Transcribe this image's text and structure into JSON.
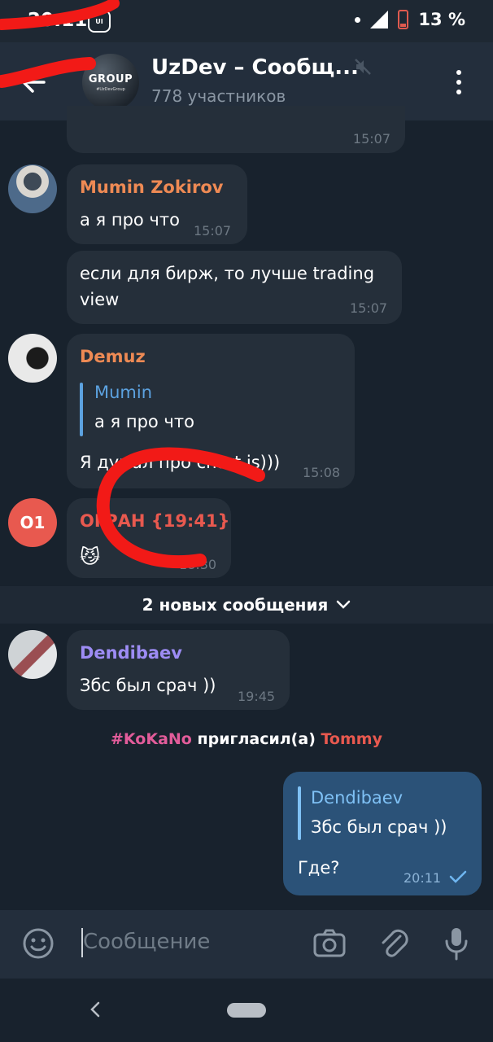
{
  "status_bar": {
    "time": "20:11",
    "app_icon": "app-icon",
    "battery": "13 %"
  },
  "header": {
    "title": "UzDev – Сообщ...",
    "members": "778 участников",
    "avatar_label": "GROUP",
    "avatar_sub": "#UzDevGroup"
  },
  "messages": {
    "m0": {
      "time": "15:07"
    },
    "m1": {
      "sender": "Mumin Zokirov",
      "text": "а я про что",
      "time": "15:07"
    },
    "m2": {
      "text_l1": "если для бирж, то лучше trading",
      "text_l2": "view",
      "time": "15:07"
    },
    "m3": {
      "sender": "Demuz",
      "reply_name": "Mumin",
      "reply_text": "а я про что",
      "text": "Я думал про chart.js)))",
      "time": "15:08"
    },
    "m4": {
      "sender": "ОГРАН {19:41}",
      "avatar_initials": "O1",
      "text": "😼",
      "time": "18:30"
    },
    "m5": {
      "sender": "Dendibaev",
      "text": "Збс был срач ))",
      "time": "19:45"
    },
    "m6": {
      "reply_name": "Dendibaev",
      "reply_text": "Збс был срач ))",
      "text": "Где?",
      "time": "20:11"
    }
  },
  "new_messages": "2 новых сообщения",
  "service": {
    "actor": "#KoKaNo",
    "action": " пригласил(а) ",
    "target": "Tommy"
  },
  "composer": {
    "placeholder": "Сообщение"
  },
  "colors": {
    "orange": "#ee8a54",
    "red": "#e8594f",
    "purple": "#9d8cf4",
    "link_blue": "#5ca2e0",
    "pink": "#e25c9a",
    "scribble": "#f21a17"
  }
}
